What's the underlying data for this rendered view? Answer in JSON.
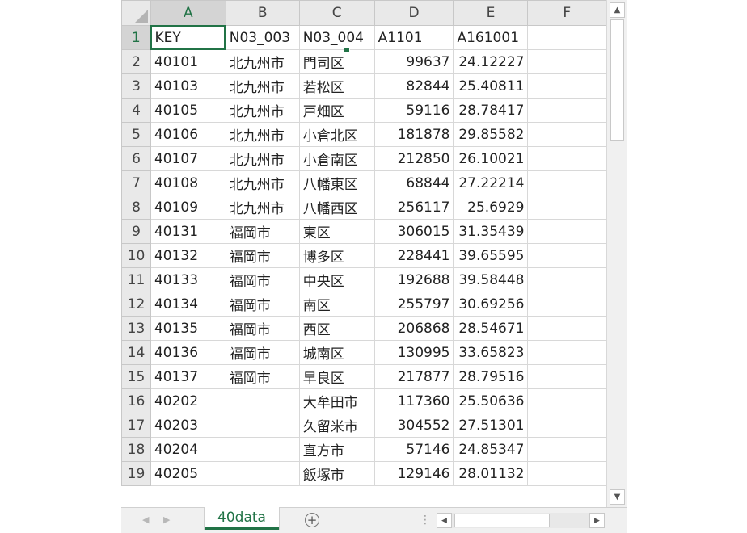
{
  "columns": [
    "A",
    "B",
    "C",
    "D",
    "E",
    "F"
  ],
  "rows": [
    {
      "n": "1",
      "a": "KEY",
      "b": "N03_003",
      "c": "N03_004",
      "d": "A1101",
      "e": "A161001"
    },
    {
      "n": "2",
      "a": "40101",
      "b": "北九州市",
      "c": "門司区",
      "d": "99637",
      "e": "24.12227"
    },
    {
      "n": "3",
      "a": "40103",
      "b": "北九州市",
      "c": "若松区",
      "d": "82844",
      "e": "25.40811"
    },
    {
      "n": "4",
      "a": "40105",
      "b": "北九州市",
      "c": "戸畑区",
      "d": "59116",
      "e": "28.78417"
    },
    {
      "n": "5",
      "a": "40106",
      "b": "北九州市",
      "c": "小倉北区",
      "d": "181878",
      "e": "29.85582"
    },
    {
      "n": "6",
      "a": "40107",
      "b": "北九州市",
      "c": "小倉南区",
      "d": "212850",
      "e": "26.10021"
    },
    {
      "n": "7",
      "a": "40108",
      "b": "北九州市",
      "c": "八幡東区",
      "d": "68844",
      "e": "27.22214"
    },
    {
      "n": "8",
      "a": "40109",
      "b": "北九州市",
      "c": "八幡西区",
      "d": "256117",
      "e": "25.6929"
    },
    {
      "n": "9",
      "a": "40131",
      "b": "福岡市",
      "c": "東区",
      "d": "306015",
      "e": "31.35439"
    },
    {
      "n": "10",
      "a": "40132",
      "b": "福岡市",
      "c": "博多区",
      "d": "228441",
      "e": "39.65595"
    },
    {
      "n": "11",
      "a": "40133",
      "b": "福岡市",
      "c": "中央区",
      "d": "192688",
      "e": "39.58448"
    },
    {
      "n": "12",
      "a": "40134",
      "b": "福岡市",
      "c": "南区",
      "d": "255797",
      "e": "30.69256"
    },
    {
      "n": "13",
      "a": "40135",
      "b": "福岡市",
      "c": "西区",
      "d": "206868",
      "e": "28.54671"
    },
    {
      "n": "14",
      "a": "40136",
      "b": "福岡市",
      "c": "城南区",
      "d": "130995",
      "e": "33.65823"
    },
    {
      "n": "15",
      "a": "40137",
      "b": "福岡市",
      "c": "早良区",
      "d": "217877",
      "e": "28.79516"
    },
    {
      "n": "16",
      "a": "40202",
      "b": "",
      "c": "大牟田市",
      "d": "117360",
      "e": "25.50636"
    },
    {
      "n": "17",
      "a": "40203",
      "b": "",
      "c": "久留米市",
      "d": "304552",
      "e": "27.51301"
    },
    {
      "n": "18",
      "a": "40204",
      "b": "",
      "c": "直方市",
      "d": "57146",
      "e": "24.85347"
    },
    {
      "n": "19",
      "a": "40205",
      "b": "",
      "c": "飯塚市",
      "d": "129146",
      "e": "28.01132"
    }
  ],
  "sheet_tab": {
    "label": "40data"
  },
  "add_sheet": {
    "icon": "plus-circle-icon",
    "glyph": "+"
  },
  "colors": {
    "accent": "#217346",
    "header_bg": "#e9e9e9",
    "gridline": "#d8d8d8"
  }
}
